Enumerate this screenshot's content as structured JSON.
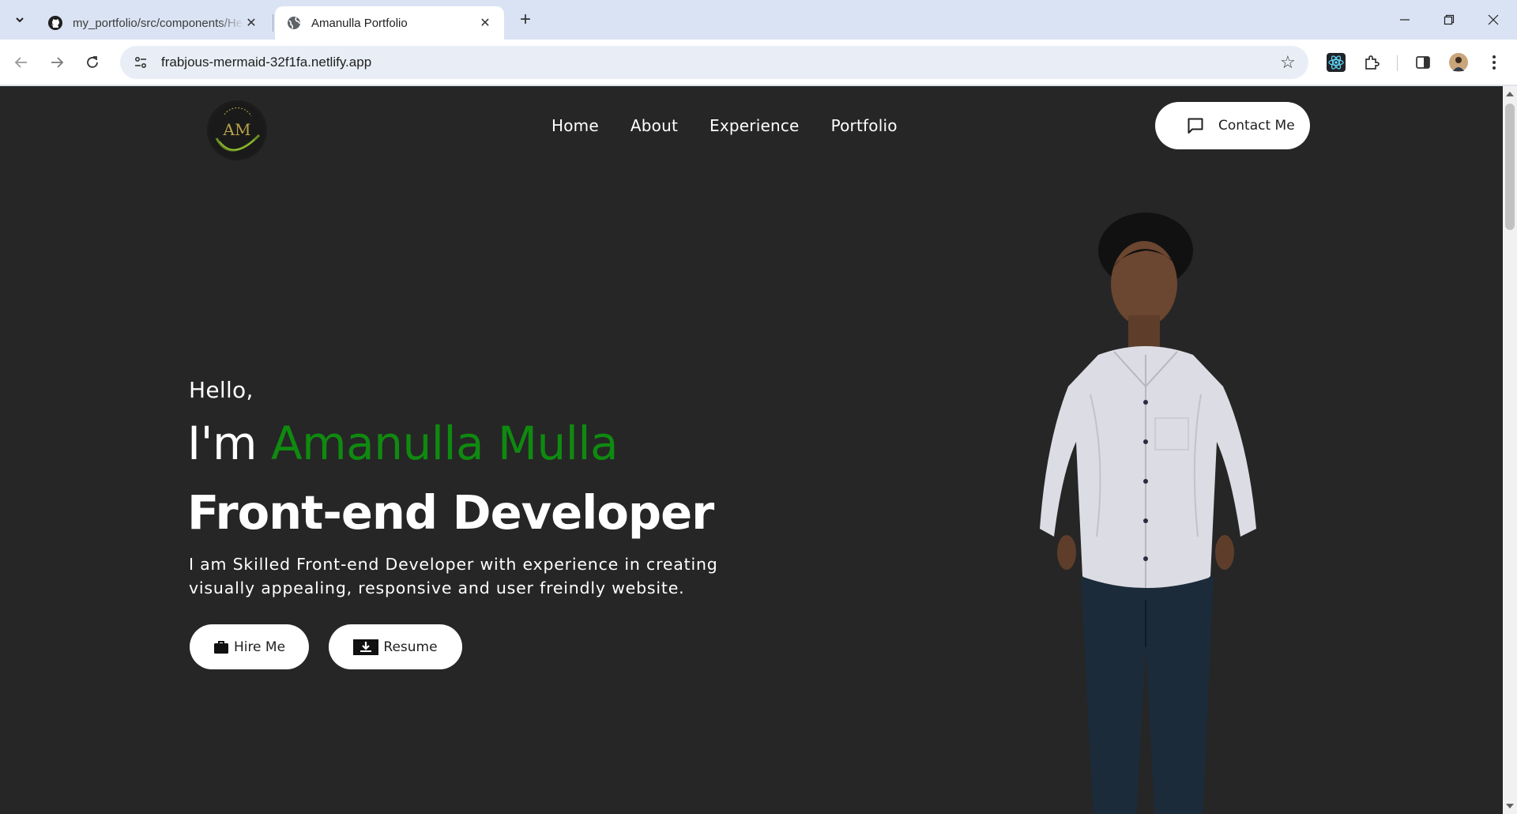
{
  "browser": {
    "tabs": [
      {
        "title": "my_portfolio/src/components/He",
        "icon": "github-icon",
        "active": false
      },
      {
        "title": "Amanulla Portfolio",
        "icon": "globe-icon",
        "active": true
      }
    ],
    "url": "frabjous-mermaid-32f1fa.netlify.app"
  },
  "page": {
    "nav": {
      "items": [
        "Home",
        "About",
        "Experience",
        "Portfolio"
      ],
      "contact_label": "Contact Me"
    },
    "hero": {
      "greeting": "Hello,",
      "im_prefix": "I'm",
      "name": "Amanulla Mulla",
      "role": "Front-end Developer",
      "description": "I am Skilled Front-end Developer with experience in creating visually appealing, responsive and user freindly website.",
      "hire_label": "Hire Me",
      "resume_label": "Resume"
    }
  },
  "colors": {
    "accent": "#0f8a10",
    "background": "#262626",
    "text": "#ffffff"
  }
}
